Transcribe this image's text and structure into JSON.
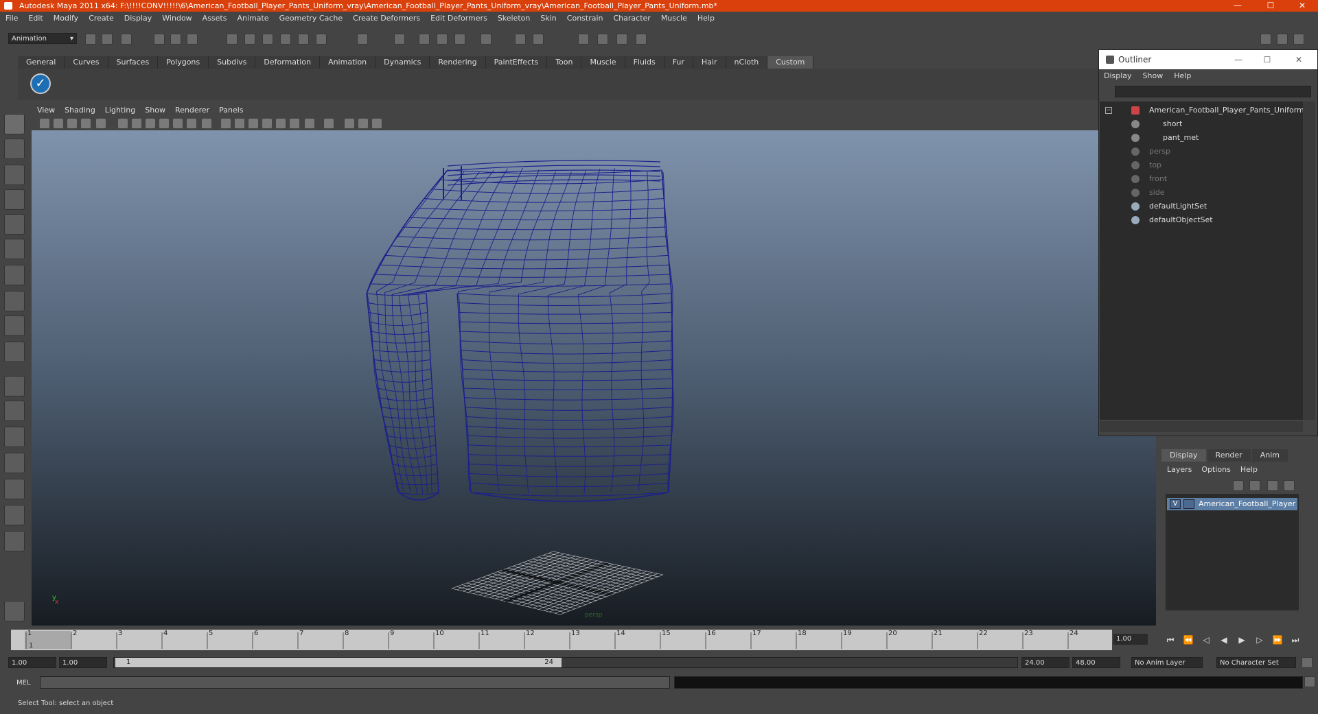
{
  "window": {
    "title": "Autodesk Maya 2011 x64: F:\\!!!!CONV!!!!!\\6\\American_Football_Player_Pants_Uniform_vray\\American_Football_Player_Pants_Uniform_vray\\American_Football_Player_Pants_Uniform.mb*",
    "minimize": "—",
    "maximize": "☐",
    "close": "✕"
  },
  "menubar": [
    "File",
    "Edit",
    "Modify",
    "Create",
    "Display",
    "Window",
    "Assets",
    "Animate",
    "Geometry Cache",
    "Create Deformers",
    "Edit Deformers",
    "Skeleton",
    "Skin",
    "Constrain",
    "Character",
    "Muscle",
    "Help"
  ],
  "statusline": {
    "mode": "Animation"
  },
  "shelf": {
    "tabs": [
      "General",
      "Curves",
      "Surfaces",
      "Polygons",
      "Subdivs",
      "Deformation",
      "Animation",
      "Dynamics",
      "Rendering",
      "PaintEffects",
      "Toon",
      "Muscle",
      "Fluids",
      "Fur",
      "Hair",
      "nCloth",
      "Custom"
    ],
    "active": "Custom",
    "button_icon": "checkmark-icon"
  },
  "viewport": {
    "menu": [
      "View",
      "Shading",
      "Lighting",
      "Show",
      "Renderer",
      "Panels"
    ],
    "camera_label": "persp",
    "axis_x": "x",
    "axis_y": "y",
    "wire_color": "#1c1f8c"
  },
  "outliner": {
    "title": "Outliner",
    "menu": [
      "Display",
      "Show",
      "Help"
    ],
    "items": [
      {
        "label": "American_Football_Player_Pants_Uniform",
        "dim": false
      },
      {
        "label": "short",
        "dim": false
      },
      {
        "label": "pant_met",
        "dim": false
      },
      {
        "label": "persp",
        "dim": true
      },
      {
        "label": "top",
        "dim": true
      },
      {
        "label": "front",
        "dim": true
      },
      {
        "label": "side",
        "dim": true
      },
      {
        "label": "defaultLightSet",
        "dim": false
      },
      {
        "label": "defaultObjectSet",
        "dim": false
      }
    ]
  },
  "layers": {
    "tabs": [
      "Display",
      "Render",
      "Anim"
    ],
    "active": "Display",
    "menu": [
      "Layers",
      "Options",
      "Help"
    ],
    "row": {
      "visible": "V",
      "name": "American_Football_Player"
    }
  },
  "timeline": {
    "ticks": [
      "1",
      "2",
      "3",
      "4",
      "5",
      "6",
      "7",
      "8",
      "9",
      "10",
      "11",
      "12",
      "13",
      "14",
      "15",
      "16",
      "17",
      "18",
      "19",
      "20",
      "21",
      "22",
      "23",
      "24"
    ],
    "current_frame": "1",
    "current_time": "1.00"
  },
  "range": {
    "start": "1.00",
    "inner_start": "1.00",
    "handle_start": "1",
    "handle_end": "24",
    "end": "24.00",
    "outer_end": "48.00",
    "anim_layer": "No Anim Layer",
    "character_set": "No Character Set"
  },
  "commandline": {
    "label": "MEL"
  },
  "helpline": {
    "text": "Select Tool: select an object"
  }
}
